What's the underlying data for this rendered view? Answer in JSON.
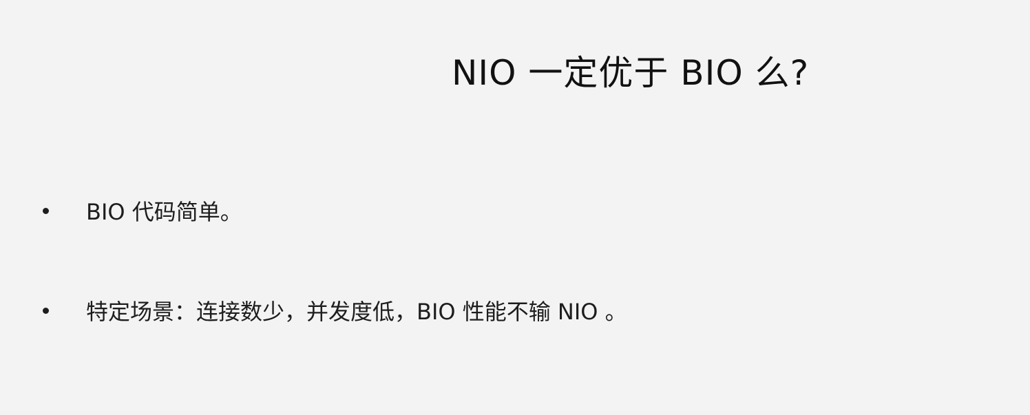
{
  "slide": {
    "title": "NIO 一定优于 BIO 么?",
    "bullets": [
      "BIO 代码简单。",
      "特定场景：连接数少，并发度低，BIO 性能不输 NIO 。"
    ]
  }
}
